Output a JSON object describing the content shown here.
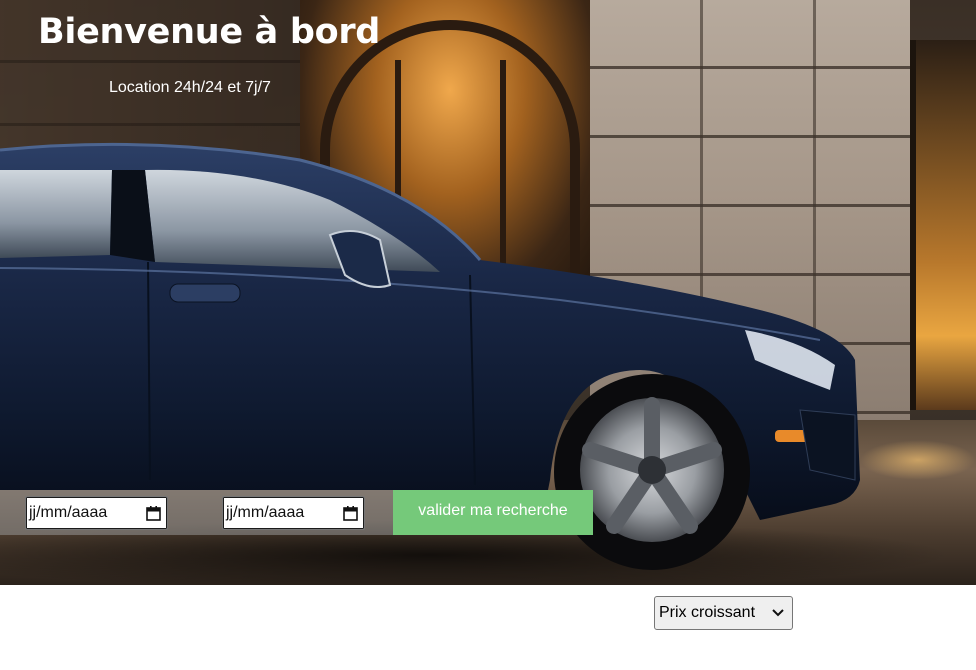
{
  "hero": {
    "title": "Bienvenue à bord",
    "subtitle": "Location 24h/24 et 7j/7"
  },
  "search": {
    "start_date_placeholder": "jj/mm/aaaa",
    "end_date_placeholder": "jj/mm/aaaa",
    "submit_label": "valider ma recherche",
    "submit_color": "#75c97a"
  },
  "sort": {
    "selected": "Prix croissant"
  },
  "icons": [
    "calendar-icon",
    "calendar-icon",
    "chevron-down-icon"
  ]
}
